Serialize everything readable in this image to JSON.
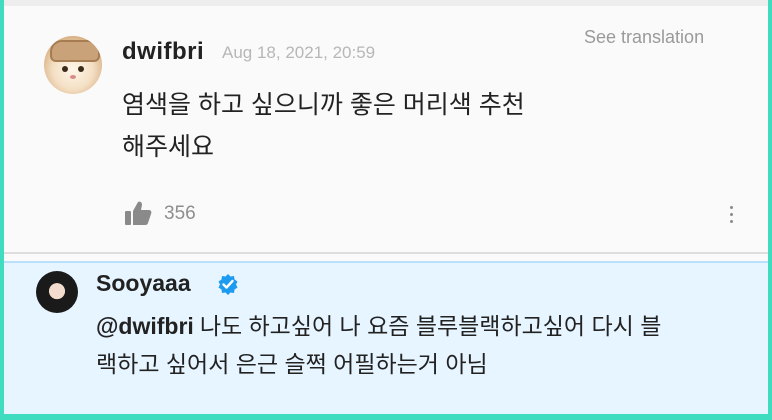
{
  "post": {
    "username": "dwifbri",
    "timestamp": "Aug 18, 2021, 20:59",
    "see_translation": "See translation",
    "text_line1": "염색을 하고 싶으니까 좋은 머리색 추천",
    "text_line2": "해주세요",
    "like_count": "356",
    "icons": {
      "like": "thumbs-up-icon",
      "more": "more-vertical-icon"
    }
  },
  "reply": {
    "username": "Sooyaaa",
    "verified_icon": "verified-badge-icon",
    "mention": "@dwifbri",
    "text_line1": "나도 하고싶어 나 요즘 블루블랙하고싶어 다시 블",
    "text_line2": "랙하고 싶어서 은근 슬쩍 어필하는거 아님"
  },
  "colors": {
    "border_accent": "#3fdcc0",
    "reply_bg": "#e6f5ff",
    "verified_blue": "#1d9bf0"
  }
}
